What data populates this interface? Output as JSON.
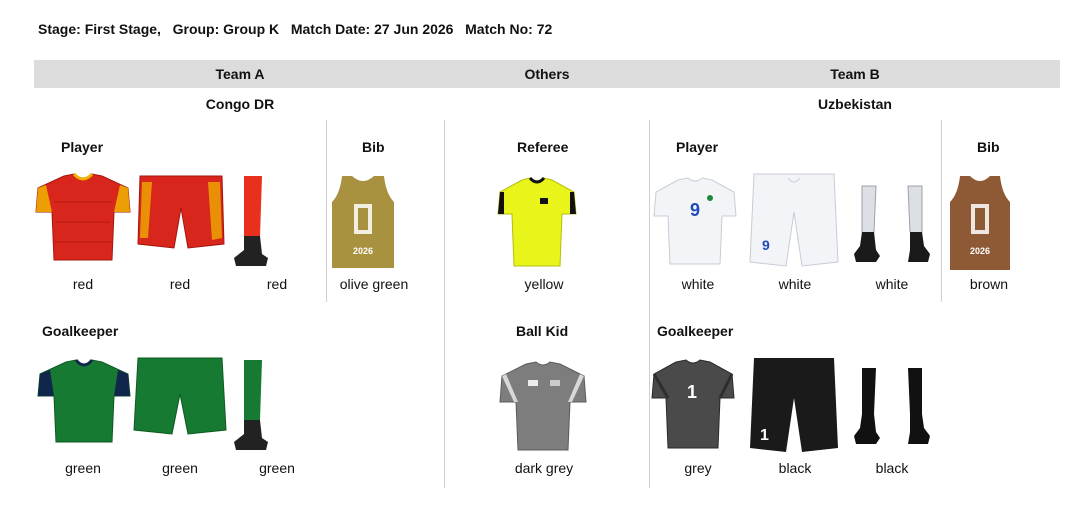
{
  "header": {
    "stage_label": "Stage:",
    "stage": "First Stage,",
    "group_label": "Group:",
    "group": "Group K",
    "date_label": "Match Date:",
    "date": "27 Jun 2026",
    "match_label": "Match No:",
    "match_no": "72"
  },
  "columns": {
    "team_a": "Team A",
    "others": "Others",
    "team_b": "Team B"
  },
  "team_a": {
    "name": "Congo DR",
    "player_title": "Player",
    "player": {
      "shirt": "red",
      "shorts": "red",
      "socks": "red"
    },
    "bib_title": "Bib",
    "bib": "olive green",
    "gk_title": "Goalkeeper",
    "goalkeeper": {
      "shirt": "green",
      "shorts": "green",
      "socks": "green"
    }
  },
  "others": {
    "referee_title": "Referee",
    "referee": "yellow",
    "ballkid_title": "Ball Kid",
    "ballkid": "dark grey"
  },
  "team_b": {
    "name": "Uzbekistan",
    "player_title": "Player",
    "player": {
      "shirt": "white",
      "shorts": "white",
      "socks": "white"
    },
    "bib_title": "Bib",
    "bib": "brown",
    "gk_title": "Goalkeeper",
    "goalkeeper": {
      "shirt": "grey",
      "shorts": "black",
      "socks": "black"
    }
  },
  "colors": {
    "red": "#d8261c",
    "red_trim": "#f0b400",
    "olive": "#a8913f",
    "green": "#167a32",
    "navy": "#10264a",
    "yellow": "#e9f51a",
    "dark_grey": "#7d7d7d",
    "white": "#f2f4f7",
    "brown": "#8e5a35",
    "grey": "#4a4a4a",
    "black": "#1a1a1a"
  }
}
